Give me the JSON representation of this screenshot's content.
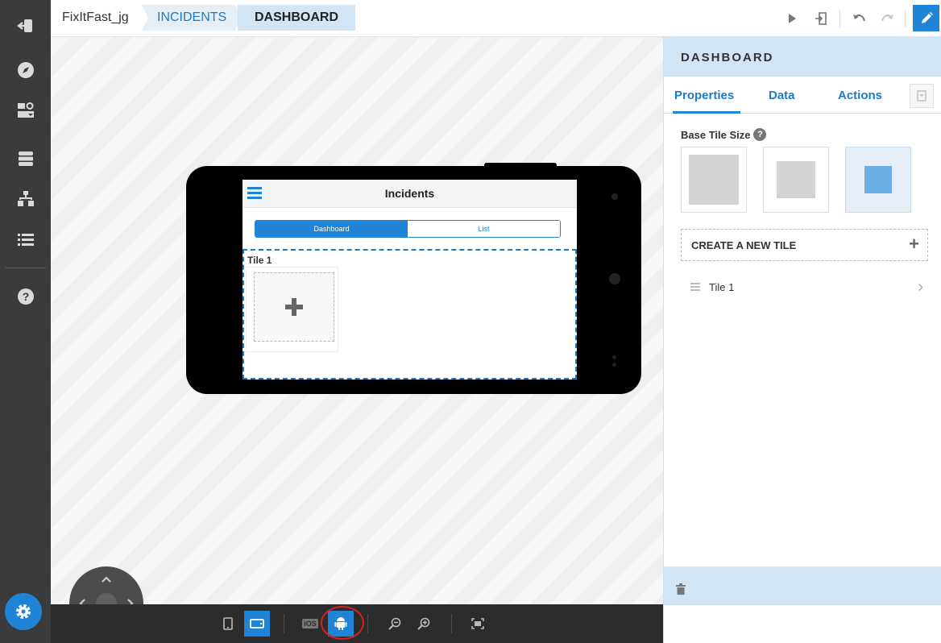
{
  "breadcrumbs": {
    "root": "FixItFast_jg",
    "items": [
      "INCIDENTS",
      "DASHBOARD"
    ]
  },
  "device_preview": {
    "app_title": "Incidents",
    "segments": [
      "Dashboard",
      "List"
    ],
    "active_segment": "Dashboard",
    "tile_label": "Tile 1"
  },
  "bottom_toolbar": {
    "ios_label": "iOS",
    "active_orientation": "landscape",
    "active_platform": "android"
  },
  "panel": {
    "title": "DASHBOARD",
    "tabs": [
      "Properties",
      "Data",
      "Actions"
    ],
    "active_tab": "Properties",
    "base_tile_size_label": "Base Tile Size",
    "help_glyph": "?",
    "tile_sizes": [
      "large",
      "medium",
      "small"
    ],
    "selected_tile_size": "small",
    "create_tile_label": "CREATE A NEW TILE",
    "tiles": [
      "Tile 1"
    ]
  },
  "colors": {
    "accent": "#1f83d6",
    "sidebar": "#393b3d",
    "panel_header": "#d2e5f5",
    "bottom_bar": "#2a2c2e"
  }
}
